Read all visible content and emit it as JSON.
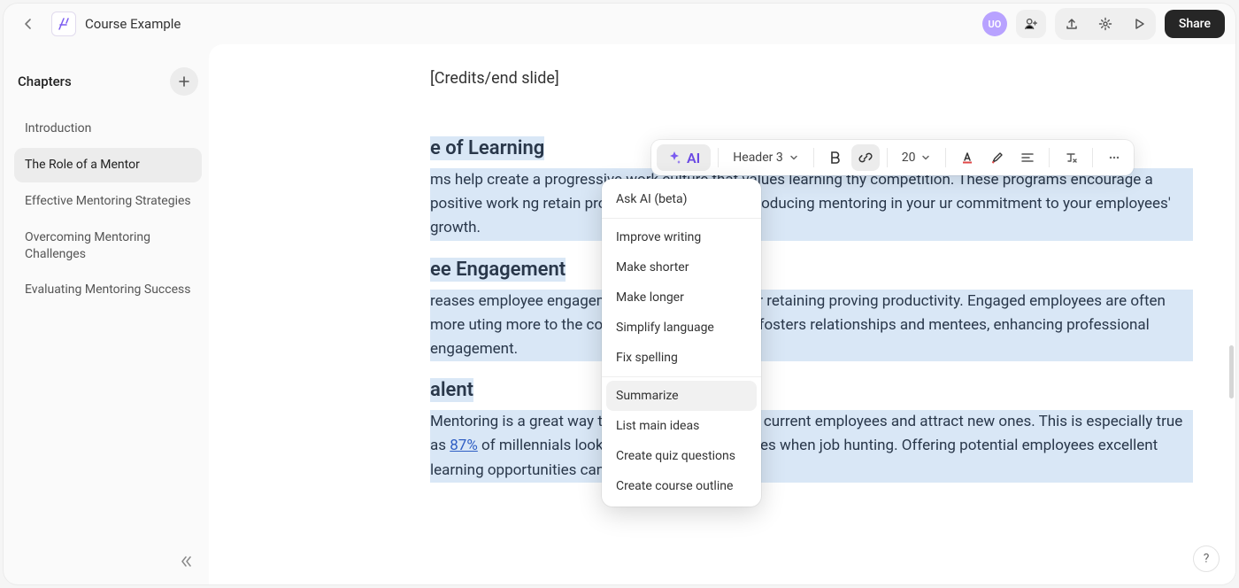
{
  "header": {
    "title": "Course Example",
    "avatar_initials": "UO",
    "share_label": "Share"
  },
  "sidebar": {
    "title": "Chapters",
    "items": [
      {
        "label": "Introduction",
        "active": false
      },
      {
        "label": "The Role of a Mentor",
        "active": true
      },
      {
        "label": "Effective Mentoring Strategies",
        "active": false
      },
      {
        "label": "Overcoming Mentoring Challenges",
        "active": false
      },
      {
        "label": "Evaluating Mentoring Success",
        "active": false
      }
    ]
  },
  "toolbar": {
    "ai_label": "AI",
    "heading_label": "Header 3",
    "font_size": "20"
  },
  "ai_menu": {
    "header_item": "Ask AI (beta)",
    "items_a": [
      "Improve writing",
      "Make shorter",
      "Make longer",
      "Simplify language",
      "Fix spelling"
    ],
    "items_b": [
      "Summarize",
      "List main ideas",
      "Create quiz questions",
      "Create course outline"
    ],
    "hovered_index": 0
  },
  "content": {
    "credits_label": "[Credits/end slide]",
    "sections": [
      {
        "heading_tail": "e of Learning",
        "paragraph_tail": "ms help create a progressive work culture that values learning thy competition. These programs encourage a positive work ng retain productive employees. Introducing mentoring in your ur commitment to your employees' growth."
      },
      {
        "heading_tail": "ee Engagement",
        "paragraph_tail": "reases employee engagement, which is crucial for retaining proving productivity. Engaged employees are often more uting more to the company. Mentoring also fosters relationships and mentees, enhancing professional engagement."
      },
      {
        "heading_tail": "alent",
        "paragraph_before_link": "Mentoring is a great way to share knowledge with current employees and attract new ones. This is especially true as ",
        "link_text": "87%",
        "paragraph_after_link": " of millennials look for learning opportunities when job hunting. Offering potential employees excellent learning opportunities can"
      }
    ]
  },
  "help_label": "?"
}
